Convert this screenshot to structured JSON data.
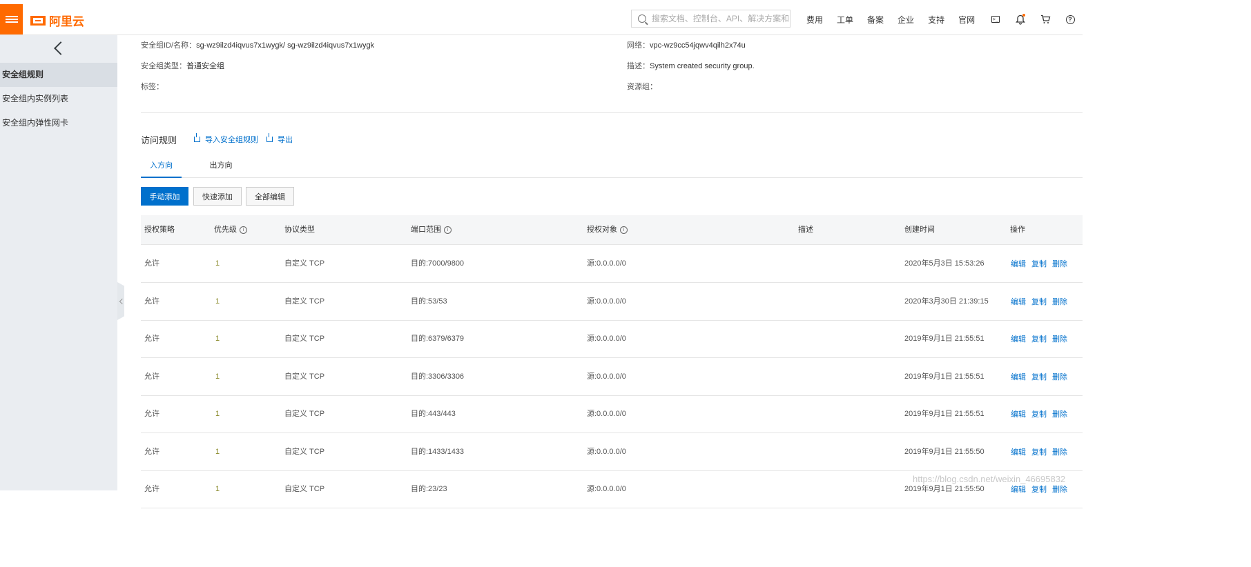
{
  "header": {
    "brand_name": "阿里云",
    "search_placeholder": "搜索文档、控制台、API、解决方案和资源",
    "nav_links": [
      "费用",
      "工单",
      "备案",
      "企业",
      "支持",
      "官网"
    ],
    "terminal_glyph": ">_"
  },
  "sidebar": {
    "items": [
      {
        "label": "安全组规则",
        "active": true
      },
      {
        "label": "安全组内实例列表",
        "active": false
      },
      {
        "label": "安全组内弹性网卡",
        "active": false
      }
    ]
  },
  "group_info": {
    "id_label": "安全组ID/名称：",
    "id_value": "sg-wz9ilzd4iqvus7x1wygk/ sg-wz9ilzd4iqvus7x1wygk",
    "type_label": "安全组类型：",
    "type_value": "普通安全组",
    "tag_label": "标签：",
    "network_label": "网络：",
    "network_value": "vpc-wz9cc54jqwv4qilh2x74u",
    "desc_label": "描述：",
    "desc_value": "System created security group.",
    "resource_group_label": "资源组："
  },
  "rules_section": {
    "title": "访问规则",
    "import_label": "导入安全组规则",
    "export_label": "导出"
  },
  "tabs": [
    {
      "label": "入方向",
      "active": true
    },
    {
      "label": "出方向",
      "active": false
    }
  ],
  "actions": {
    "manual_add": "手动添加",
    "quick_add": "快速添加",
    "edit_all": "全部编辑"
  },
  "table": {
    "columns": [
      "授权策略",
      "优先级",
      "协议类型",
      "端口范围",
      "授权对象",
      "描述",
      "创建时间",
      "操作"
    ],
    "info_glyph": "i",
    "op_labels": {
      "edit": "编辑",
      "copy": "复制",
      "delete": "删除"
    },
    "rows": [
      {
        "policy": "允许",
        "priority": "1",
        "protocol": "自定义 TCP",
        "port": "目的:7000/9800",
        "source": "源:0.0.0.0/0",
        "desc": "",
        "created": "2020年5月3日 15:53:26"
      },
      {
        "policy": "允许",
        "priority": "1",
        "protocol": "自定义 TCP",
        "port": "目的:53/53",
        "source": "源:0.0.0.0/0",
        "desc": "",
        "created": "2020年3月30日 21:39:15"
      },
      {
        "policy": "允许",
        "priority": "1",
        "protocol": "自定义 TCP",
        "port": "目的:6379/6379",
        "source": "源:0.0.0.0/0",
        "desc": "",
        "created": "2019年9月1日 21:55:51"
      },
      {
        "policy": "允许",
        "priority": "1",
        "protocol": "自定义 TCP",
        "port": "目的:3306/3306",
        "source": "源:0.0.0.0/0",
        "desc": "",
        "created": "2019年9月1日 21:55:51"
      },
      {
        "policy": "允许",
        "priority": "1",
        "protocol": "自定义 TCP",
        "port": "目的:443/443",
        "source": "源:0.0.0.0/0",
        "desc": "",
        "created": "2019年9月1日 21:55:51"
      },
      {
        "policy": "允许",
        "priority": "1",
        "protocol": "自定义 TCP",
        "port": "目的:1433/1433",
        "source": "源:0.0.0.0/0",
        "desc": "",
        "created": "2019年9月1日 21:55:50"
      },
      {
        "policy": "允许",
        "priority": "1",
        "protocol": "自定义 TCP",
        "port": "目的:23/23",
        "source": "源:0.0.0.0/0",
        "desc": "",
        "created": "2019年9月1日 21:55:50"
      }
    ]
  },
  "watermark": "https://blog.csdn.net/weixin_46695832",
  "colors": {
    "brand": "#ff6a00",
    "primary": "#0070cc",
    "sidebar_bg": "#eaedf1"
  }
}
